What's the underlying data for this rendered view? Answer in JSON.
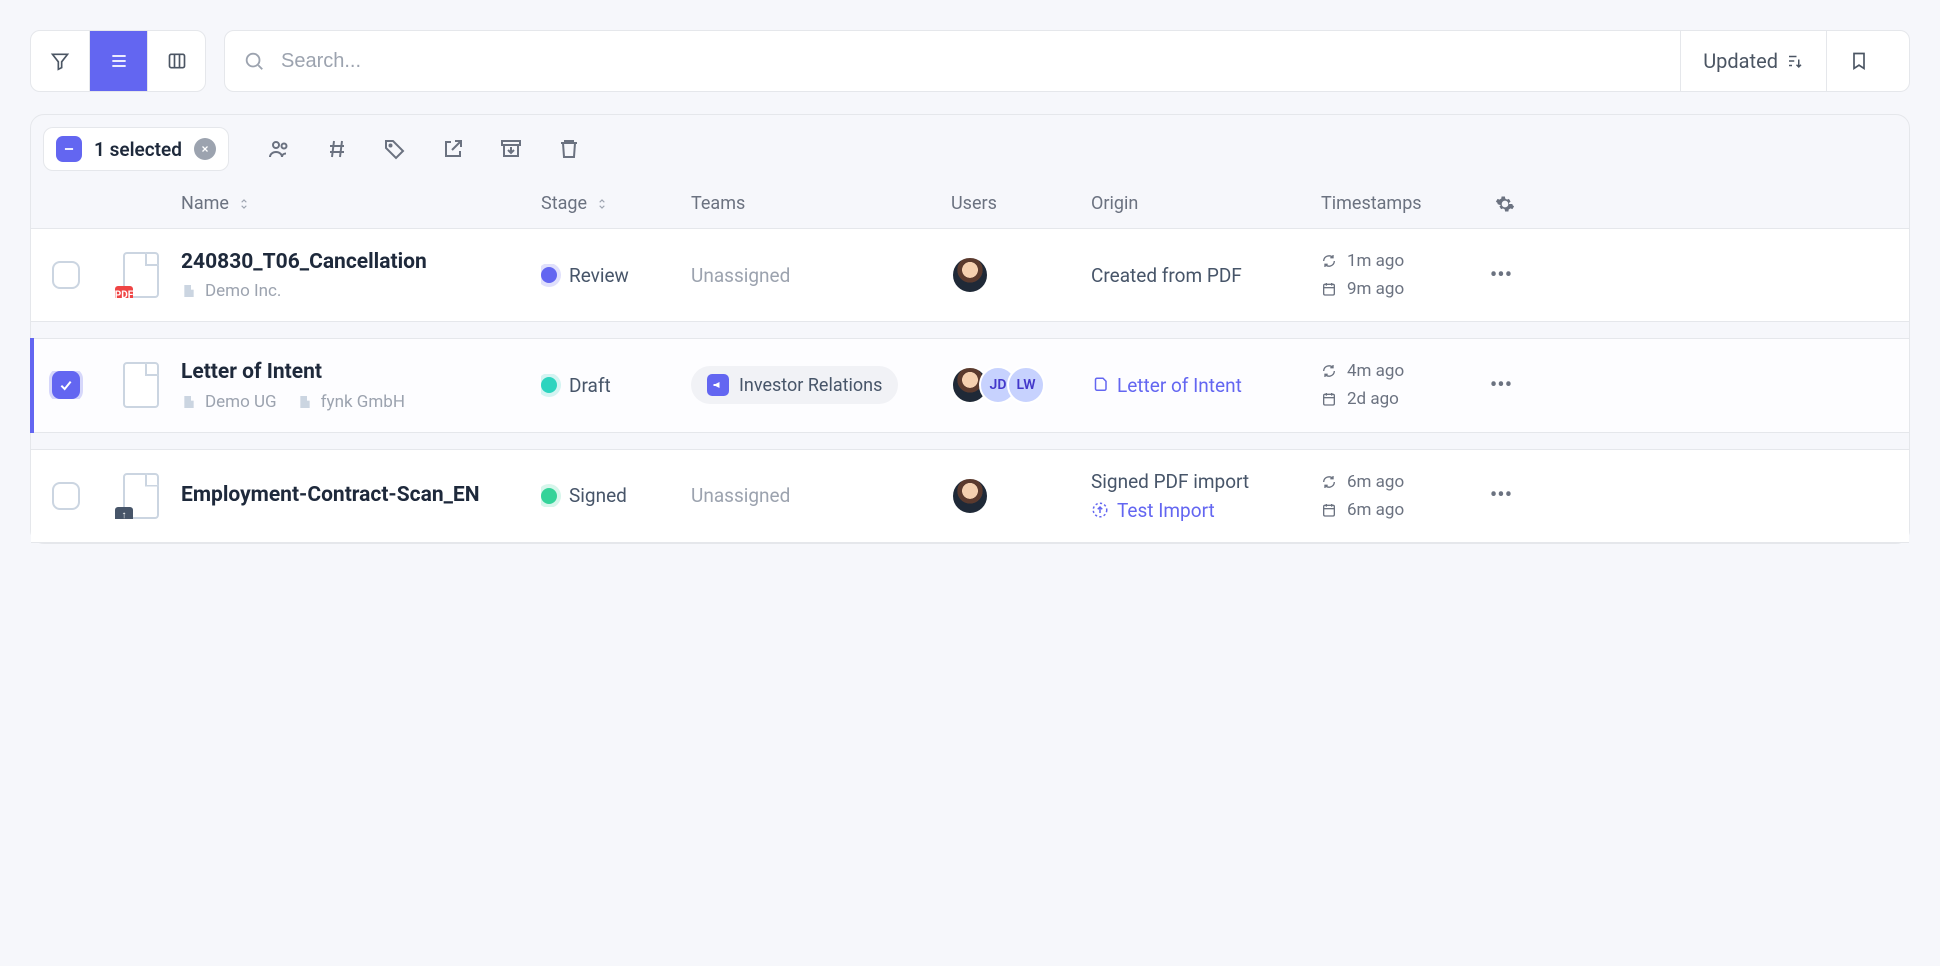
{
  "toolbar": {
    "search_placeholder": "Search...",
    "sort_label": "Updated"
  },
  "bulk": {
    "selected_label": "1 selected"
  },
  "columns": {
    "name": "Name",
    "stage": "Stage",
    "teams": "Teams",
    "users": "Users",
    "origin": "Origin",
    "timestamps": "Timestamps"
  },
  "rows": [
    {
      "title": "240830_T06_Cancellation",
      "companies": [
        "Demo Inc."
      ],
      "doc_badge": "pdf",
      "stage": {
        "label": "Review",
        "kind": "review"
      },
      "team_unassigned": "Unassigned",
      "origin_text": "Created from PDF",
      "ts_updated": "1m ago",
      "ts_created": "9m ago",
      "selected": false
    },
    {
      "title": "Letter of Intent",
      "companies": [
        "Demo UG",
        "fynk GmbH"
      ],
      "doc_badge": "",
      "stage": {
        "label": "Draft",
        "kind": "draft"
      },
      "team_tag": "Investor Relations",
      "users_extra": [
        "JD",
        "LW"
      ],
      "origin_link": "Letter of Intent",
      "ts_updated": "4m ago",
      "ts_created": "2d ago",
      "selected": true
    },
    {
      "title": "Employment-Contract-Scan_EN",
      "companies": [],
      "doc_badge": "upload",
      "stage": {
        "label": "Signed",
        "kind": "signed"
      },
      "team_unassigned": "Unassigned",
      "origin_text": "Signed PDF import",
      "origin_link": "Test Import",
      "ts_updated": "6m ago",
      "ts_created": "6m ago",
      "selected": false
    }
  ]
}
